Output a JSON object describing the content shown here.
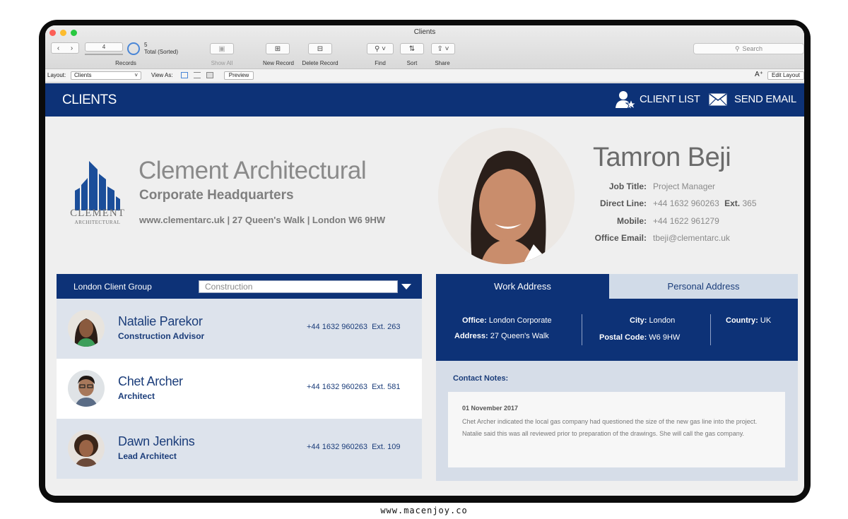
{
  "window": {
    "title": "Clients",
    "record_value": "4",
    "records_label": "Records",
    "total_count": "5",
    "total_label": "Total (Sorted)",
    "show_all": "Show All",
    "new_record": "New Record",
    "delete_record": "Delete Record",
    "find": "Find",
    "sort": "Sort",
    "share": "Share",
    "search_placeholder": "Search"
  },
  "layoutbar": {
    "layout_label": "Layout:",
    "layout_value": "Clients",
    "view_as": "View As:",
    "preview": "Preview",
    "font_glyph": "A⁺",
    "edit_layout": "Edit Layout"
  },
  "appbar": {
    "title": "CLIENTS",
    "client_list": "CLIENT LIST",
    "send_email": "SEND EMAIL"
  },
  "company": {
    "logo_name": "CLEMENT",
    "logo_sub": "ARCHITECTURAL",
    "name": "Clement Architectural",
    "subtitle": "Corporate Headquarters",
    "address": "www.clementarc.uk | 27 Queen's Walk | London W6 9HW"
  },
  "person": {
    "name": "Tamron Beji",
    "job_title_label": "Job Title:",
    "job_title": "Project Manager",
    "direct_label": "Direct Line:",
    "direct": "+44 1632 960263",
    "ext_label": "Ext.",
    "ext": "365",
    "mobile_label": "Mobile:",
    "mobile": "+44 1622 961279",
    "email_label": "Office Email:",
    "email": "tbeji@clementarc.uk"
  },
  "group": {
    "label": "London Client Group",
    "select_value": "Construction"
  },
  "clients": [
    {
      "name": "Natalie Parekor",
      "role": "Construction Advisor",
      "phone": "+44 1632 960263",
      "ext_label": "Ext.",
      "ext": "263"
    },
    {
      "name": "Chet Archer",
      "role": "Architect",
      "phone": "+44 1632 960263",
      "ext_label": "Ext.",
      "ext": "581"
    },
    {
      "name": "Dawn Jenkins",
      "role": "Lead Architect",
      "phone": "+44 1632 960263",
      "ext_label": "Ext.",
      "ext": "109"
    }
  ],
  "tabs": {
    "work": "Work Address",
    "personal": "Personal Address"
  },
  "address": {
    "office_label": "Office:",
    "office": "London Corporate",
    "address_label": "Address:",
    "address": "27 Queen's Walk",
    "city_label": "City:",
    "city": "London",
    "postal_label": "Postal Code:",
    "postal": "W6 9HW",
    "country_label": "Country:",
    "country": "UK"
  },
  "notes": {
    "title": "Contact Notes:",
    "date": "01 November 2017",
    "body": "Chet Archer indicated the local gas company had questioned the size of the new gas line into the project. Natalie said this was all reviewed prior to preparation of the drawings. She will call the gas company."
  },
  "footer_url": "www.macenjoy.co",
  "colors": {
    "brand_blue": "#0d3277",
    "row_alt": "#dde3ec",
    "tab_inactive": "#d1dbe8"
  }
}
